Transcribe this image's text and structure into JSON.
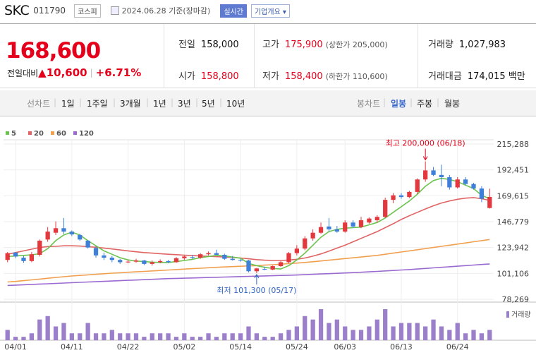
{
  "header": {
    "name": "SKC",
    "code": "011790",
    "market": "코스피",
    "date": "2024.06.28 기준(장마감)",
    "realtime": "실시간",
    "company_info": "기업개요 ▾"
  },
  "summary": {
    "price": "168,600",
    "change_label": "전일대비",
    "change_amount": "▲10,600",
    "change_pct": "+6.71%",
    "prev_close_label": "전일",
    "prev_close": "158,000",
    "open_label": "시가",
    "open": "158,800",
    "high_label": "고가",
    "high": "175,900",
    "upper_limit": "(상한가 205,000)",
    "low_label": "저가",
    "low": "158,400",
    "lower_limit": "(하한가 110,600)",
    "volume_label": "거래량",
    "volume": "1,027,983",
    "amount_label": "거래대금",
    "amount": "174,015 백만"
  },
  "toolbar": {
    "line_label": "선차트",
    "periods": [
      "1일",
      "1주일",
      "3개월",
      "1년",
      "3년",
      "5년",
      "10년"
    ],
    "candle_label": "봉차트",
    "candle_periods": [
      "일봉",
      "주봉",
      "월봉"
    ],
    "active": "일봉"
  },
  "colors": {
    "up": "#e3383d",
    "down": "#3d7fd9",
    "ma5": "#6cc44f",
    "ma20": "#e06464",
    "ma60": "#f0a050",
    "ma120": "#9a6ad0",
    "volume": "#9b7fca"
  },
  "chart_data": {
    "type": "candlestick",
    "legend": [
      "5",
      "20",
      "60",
      "120"
    ],
    "y_ticks": [
      "215,288",
      "192,451",
      "169,615",
      "146,779",
      "123,942",
      "101,106",
      "78,269"
    ],
    "ylim": [
      78269,
      215288
    ],
    "x_ticks": [
      "04/01",
      "04/11",
      "04/22",
      "05/02",
      "05/14",
      "05/24",
      "06/03",
      "06/13",
      "06/24"
    ],
    "max_label": "최고 200,000 (06/18)",
    "min_label": "최저 101,300 (05/17)",
    "volume_label": "거래량",
    "candles": [
      {
        "d": "03/29",
        "o": 113000,
        "h": 120000,
        "l": 111000,
        "c": 119000
      },
      {
        "d": "04/01",
        "o": 119500,
        "h": 120000,
        "l": 114500,
        "c": 116000
      },
      {
        "d": "04/02",
        "o": 115000,
        "h": 116500,
        "l": 110500,
        "c": 112000
      },
      {
        "d": "04/03",
        "o": 112000,
        "h": 120000,
        "l": 111000,
        "c": 118000
      },
      {
        "d": "04/04",
        "o": 117500,
        "h": 131000,
        "l": 116000,
        "c": 130000
      },
      {
        "d": "04/05",
        "o": 131000,
        "h": 142000,
        "l": 129000,
        "c": 138000
      },
      {
        "d": "04/08",
        "o": 137000,
        "h": 147000,
        "l": 135000,
        "c": 141000
      },
      {
        "d": "04/09",
        "o": 141000,
        "h": 150000,
        "l": 136000,
        "c": 138000
      },
      {
        "d": "04/11",
        "o": 138000,
        "h": 139000,
        "l": 134000,
        "c": 135500
      },
      {
        "d": "04/12",
        "o": 135000,
        "h": 136000,
        "l": 130000,
        "c": 131000
      },
      {
        "d": "04/15",
        "o": 130000,
        "h": 130500,
        "l": 123000,
        "c": 124000
      },
      {
        "d": "04/16",
        "o": 123500,
        "h": 125000,
        "l": 115000,
        "c": 117000
      },
      {
        "d": "04/17",
        "o": 117000,
        "h": 119500,
        "l": 113000,
        "c": 115000
      },
      {
        "d": "04/18",
        "o": 115000,
        "h": 116500,
        "l": 111000,
        "c": 113000
      },
      {
        "d": "04/19",
        "o": 113000,
        "h": 114000,
        "l": 109500,
        "c": 111000
      },
      {
        "d": "04/22",
        "o": 111000,
        "h": 113000,
        "l": 110000,
        "c": 111500
      },
      {
        "d": "04/23",
        "o": 111500,
        "h": 114000,
        "l": 110500,
        "c": 112500
      },
      {
        "d": "04/24",
        "o": 112500,
        "h": 113000,
        "l": 108500,
        "c": 109500
      },
      {
        "d": "04/25",
        "o": 109500,
        "h": 112500,
        "l": 108000,
        "c": 111000
      },
      {
        "d": "04/26",
        "o": 111000,
        "h": 113500,
        "l": 110000,
        "c": 112000
      },
      {
        "d": "04/29",
        "o": 112000,
        "h": 113000,
        "l": 110000,
        "c": 111000
      },
      {
        "d": "04/30",
        "o": 111000,
        "h": 115500,
        "l": 110500,
        "c": 114500
      },
      {
        "d": "05/02",
        "o": 114500,
        "h": 117000,
        "l": 113000,
        "c": 116000
      },
      {
        "d": "05/03",
        "o": 115500,
        "h": 117500,
        "l": 114000,
        "c": 115000
      },
      {
        "d": "05/07",
        "o": 115000,
        "h": 119000,
        "l": 114000,
        "c": 118000
      },
      {
        "d": "05/08",
        "o": 118000,
        "h": 120500,
        "l": 117000,
        "c": 119000
      },
      {
        "d": "05/09",
        "o": 119000,
        "h": 122000,
        "l": 117500,
        "c": 117500
      },
      {
        "d": "05/10",
        "o": 117500,
        "h": 118500,
        "l": 113000,
        "c": 114000
      },
      {
        "d": "05/13",
        "o": 114000,
        "h": 116500,
        "l": 112500,
        "c": 113000
      },
      {
        "d": "05/14",
        "o": 113000,
        "h": 114000,
        "l": 111500,
        "c": 112500
      },
      {
        "d": "05/16",
        "o": 112500,
        "h": 113000,
        "l": 102000,
        "c": 103000
      },
      {
        "d": "05/17",
        "o": 103000,
        "h": 106000,
        "l": 101300,
        "c": 105500
      },
      {
        "d": "05/20",
        "o": 105000,
        "h": 107000,
        "l": 104000,
        "c": 104500
      },
      {
        "d": "05/21",
        "o": 104500,
        "h": 108000,
        "l": 104000,
        "c": 107500
      },
      {
        "d": "05/22",
        "o": 107500,
        "h": 112000,
        "l": 107000,
        "c": 111000
      },
      {
        "d": "05/23",
        "o": 111000,
        "h": 120000,
        "l": 110000,
        "c": 119000
      },
      {
        "d": "05/24",
        "o": 119000,
        "h": 126000,
        "l": 117000,
        "c": 123000
      },
      {
        "d": "05/27",
        "o": 123000,
        "h": 134000,
        "l": 121500,
        "c": 132000
      },
      {
        "d": "05/28",
        "o": 132000,
        "h": 140000,
        "l": 130000,
        "c": 137000
      },
      {
        "d": "05/29",
        "o": 137000,
        "h": 146000,
        "l": 136000,
        "c": 142000
      },
      {
        "d": "05/30",
        "o": 142500,
        "h": 150000,
        "l": 138000,
        "c": 140000
      },
      {
        "d": "05/31",
        "o": 140000,
        "h": 143000,
        "l": 137000,
        "c": 138000
      },
      {
        "d": "06/03",
        "o": 138000,
        "h": 148000,
        "l": 137000,
        "c": 146000
      },
      {
        "d": "06/04",
        "o": 146000,
        "h": 148000,
        "l": 141000,
        "c": 142500
      },
      {
        "d": "06/05",
        "o": 142000,
        "h": 151000,
        "l": 141000,
        "c": 148000
      },
      {
        "d": "06/07",
        "o": 146000,
        "h": 150500,
        "l": 145000,
        "c": 149500
      },
      {
        "d": "06/10",
        "o": 148000,
        "h": 152500,
        "l": 146000,
        "c": 151000
      },
      {
        "d": "06/11",
        "o": 151000,
        "h": 168000,
        "l": 150000,
        "c": 166000
      },
      {
        "d": "06/12",
        "o": 166000,
        "h": 172000,
        "l": 163000,
        "c": 170000
      },
      {
        "d": "06/13",
        "o": 170000,
        "h": 172000,
        "l": 167000,
        "c": 168500
      },
      {
        "d": "06/14",
        "o": 168500,
        "h": 174000,
        "l": 167500,
        "c": 173000
      },
      {
        "d": "06/17",
        "o": 173000,
        "h": 185000,
        "l": 171000,
        "c": 184000
      },
      {
        "d": "06/18",
        "o": 184000,
        "h": 200000,
        "l": 182000,
        "c": 192000
      },
      {
        "d": "06/19",
        "o": 192000,
        "h": 195000,
        "l": 187000,
        "c": 188000
      },
      {
        "d": "06/20",
        "o": 188000,
        "h": 197000,
        "l": 178000,
        "c": 186000
      },
      {
        "d": "06/21",
        "o": 186000,
        "h": 188000,
        "l": 175000,
        "c": 177000
      },
      {
        "d": "06/24",
        "o": 177000,
        "h": 186000,
        "l": 176000,
        "c": 184000
      },
      {
        "d": "06/25",
        "o": 184000,
        "h": 186000,
        "l": 179000,
        "c": 180000
      },
      {
        "d": "06/26",
        "o": 180000,
        "h": 181000,
        "l": 175000,
        "c": 176000
      },
      {
        "d": "06/27",
        "o": 176000,
        "h": 178000,
        "l": 164000,
        "c": 167000
      },
      {
        "d": "06/28",
        "o": 158800,
        "h": 175900,
        "l": 158400,
        "c": 168600
      }
    ],
    "volume": [
      3,
      1,
      1,
      2,
      6,
      7,
      4,
      5,
      2,
      2,
      5,
      2,
      2,
      3,
      2,
      2,
      2,
      1,
      2,
      2,
      2,
      1,
      2,
      1,
      1,
      2,
      1,
      2,
      2,
      2,
      4,
      2,
      1,
      1,
      2,
      3,
      4,
      7,
      6,
      9,
      5,
      6,
      4,
      3,
      3,
      4,
      6,
      9,
      4,
      5,
      5,
      5,
      4,
      6,
      4,
      3,
      5,
      2,
      3,
      2,
      3
    ],
    "ma5": [
      116000,
      116500,
      117000,
      117500,
      118500,
      123000,
      130000,
      135000,
      137500,
      135000,
      130000,
      125500,
      121000,
      118000,
      115000,
      113000,
      112000,
      111500,
      111000,
      110800,
      110800,
      111500,
      112500,
      113500,
      115000,
      116000,
      117000,
      116500,
      115500,
      114500,
      110000,
      108000,
      106500,
      105500,
      105000,
      108000,
      113000,
      119000,
      126000,
      133000,
      138000,
      140000,
      141000,
      141500,
      142000,
      144000,
      146000,
      150000,
      155000,
      160000,
      165000,
      171000,
      178000,
      183000,
      185000,
      184000,
      182000,
      179000,
      176000,
      170000,
      167000
    ],
    "ma20": [
      118000,
      119500,
      121000,
      122500,
      124000,
      124800,
      125000,
      125500,
      125500,
      125200,
      124800,
      124200,
      123500,
      122700,
      121800,
      121000,
      120200,
      119500,
      119000,
      118500,
      118000,
      117600,
      117200,
      116800,
      116500,
      116200,
      115900,
      115600,
      115200,
      114700,
      114000,
      113300,
      112800,
      112500,
      112500,
      112900,
      113600,
      114700,
      116300,
      118300,
      120800,
      123400,
      126000,
      129000,
      132000,
      135000,
      138000,
      141500,
      145000,
      148700,
      152000,
      155000,
      158000,
      160800,
      163200,
      165000,
      166500,
      167500,
      168000,
      167000,
      165500
    ],
    "ma60": [
      93500,
      94000,
      94700,
      95400,
      96100,
      96800,
      97500,
      98200,
      98800,
      99300,
      99800,
      100300,
      100800,
      101300,
      101700,
      102100,
      102500,
      102900,
      103300,
      103700,
      104100,
      104500,
      104900,
      105300,
      105700,
      106100,
      106500,
      106800,
      107100,
      107400,
      107700,
      108000,
      108400,
      108800,
      109200,
      109700,
      110200,
      110800,
      111400,
      112100,
      112800,
      113500,
      114200,
      114900,
      115600,
      116300,
      117000,
      118000,
      119000,
      120000,
      121000,
      122000,
      123000,
      124000,
      125000,
      126000,
      127000,
      128000,
      129000,
      130000,
      131000
    ],
    "ma120": [
      90500,
      90800,
      91100,
      91400,
      91700,
      92000,
      92300,
      92600,
      92900,
      93200,
      93500,
      93800,
      94100,
      94400,
      94700,
      95000,
      95300,
      95600,
      95900,
      96200,
      96500,
      96700,
      96900,
      97100,
      97300,
      97500,
      97700,
      97900,
      98100,
      98300,
      98500,
      98700,
      98900,
      99100,
      99300,
      99500,
      99700,
      100000,
      100300,
      100600,
      100900,
      101200,
      101500,
      101800,
      102100,
      102500,
      102900,
      103300,
      103700,
      104100,
      104500,
      105000,
      105500,
      106000,
      106500,
      107000,
      107500,
      108000,
      108500,
      109000,
      109500
    ]
  }
}
